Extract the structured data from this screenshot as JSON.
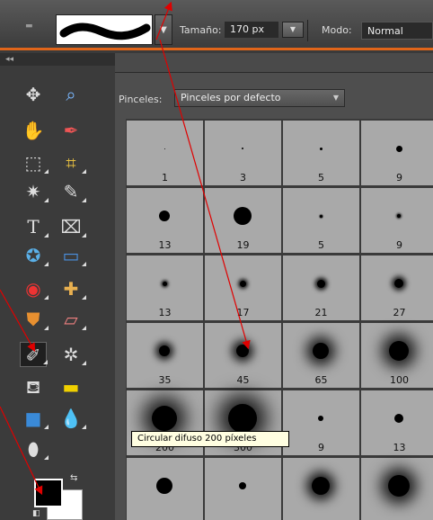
{
  "options_bar": {
    "size_label": "Tamaño:",
    "size_value": "170 px",
    "mode_label": "Modo:",
    "mode_value": "Normal"
  },
  "toolbox": {
    "collapse_label": "◂◂",
    "tools": [
      {
        "name": "move-tool",
        "glyph": "✥"
      },
      {
        "name": "zoom-tool",
        "glyph": "🔍"
      },
      {
        "name": "hand-tool",
        "glyph": "✋"
      },
      {
        "name": "eyedropper-tool",
        "glyph": "✒"
      },
      {
        "name": "marquee-tool",
        "glyph": "⬚"
      },
      {
        "name": "lasso-tool",
        "glyph": "⌗"
      },
      {
        "name": "magic-wand-tool",
        "glyph": "✷"
      },
      {
        "name": "quick-selection-tool",
        "glyph": "✎"
      },
      {
        "name": "type-tool",
        "glyph": "T"
      },
      {
        "name": "crop-tool",
        "glyph": "⌧"
      },
      {
        "name": "cookie-cutter-tool",
        "glyph": "✪"
      },
      {
        "name": "straighten-tool",
        "glyph": "▭"
      },
      {
        "name": "red-eye-tool",
        "glyph": "◉"
      },
      {
        "name": "healing-brush-tool",
        "glyph": "✚"
      },
      {
        "name": "clone-stamp-tool",
        "glyph": "⛊"
      },
      {
        "name": "eraser-tool",
        "glyph": "▱"
      },
      {
        "name": "brush-tool",
        "glyph": "🖌"
      },
      {
        "name": "smart-brush-tool",
        "glyph": "✲"
      },
      {
        "name": "paint-bucket-tool",
        "glyph": "⛾"
      },
      {
        "name": "gradient-tool",
        "glyph": "▬"
      },
      {
        "name": "shape-tool",
        "glyph": "■"
      },
      {
        "name": "blur-tool",
        "glyph": "💧"
      },
      {
        "name": "sponge-tool",
        "glyph": "⬮"
      }
    ]
  },
  "brush_panel": {
    "brushes_label": "Pinceles:",
    "brushes_set": "Pinceles por defecto",
    "brushes": [
      {
        "label": "1",
        "size": 1,
        "blur": 0
      },
      {
        "label": "3",
        "size": 2,
        "blur": 0
      },
      {
        "label": "5",
        "size": 3,
        "blur": 0
      },
      {
        "label": "9",
        "size": 7,
        "blur": 0
      },
      {
        "label": "13",
        "size": 12,
        "blur": 0
      },
      {
        "label": "19",
        "size": 20,
        "blur": 0
      },
      {
        "label": "5",
        "size": 3,
        "blur": 0.6
      },
      {
        "label": "9",
        "size": 4,
        "blur": 1
      },
      {
        "label": "13",
        "size": 5,
        "blur": 1.5
      },
      {
        "label": "17",
        "size": 7,
        "blur": 2
      },
      {
        "label": "21",
        "size": 9,
        "blur": 2.5
      },
      {
        "label": "27",
        "size": 10,
        "blur": 3
      },
      {
        "label": "35",
        "size": 12,
        "blur": 4
      },
      {
        "label": "45",
        "size": 14,
        "blur": 5
      },
      {
        "label": "65",
        "size": 18,
        "blur": 7
      },
      {
        "label": "100",
        "size": 22,
        "blur": 8
      },
      {
        "label": "200",
        "size": 28,
        "blur": 10
      },
      {
        "label": "300",
        "size": 32,
        "blur": 11
      },
      {
        "label": "9",
        "size": 6,
        "blur": 0
      },
      {
        "label": "13",
        "size": 10,
        "blur": 0
      },
      {
        "label": "",
        "size": 18,
        "blur": 0
      },
      {
        "label": "",
        "size": 8,
        "blur": 0
      },
      {
        "label": "",
        "size": 20,
        "blur": 6
      },
      {
        "label": "",
        "size": 24,
        "blur": 8
      }
    ]
  },
  "tooltip": "Circular difuso 200 píxeles",
  "colors": {
    "accent": "#e0651a",
    "arrow": "#e00000",
    "foreground": "#000000",
    "background": "#ffffff"
  }
}
